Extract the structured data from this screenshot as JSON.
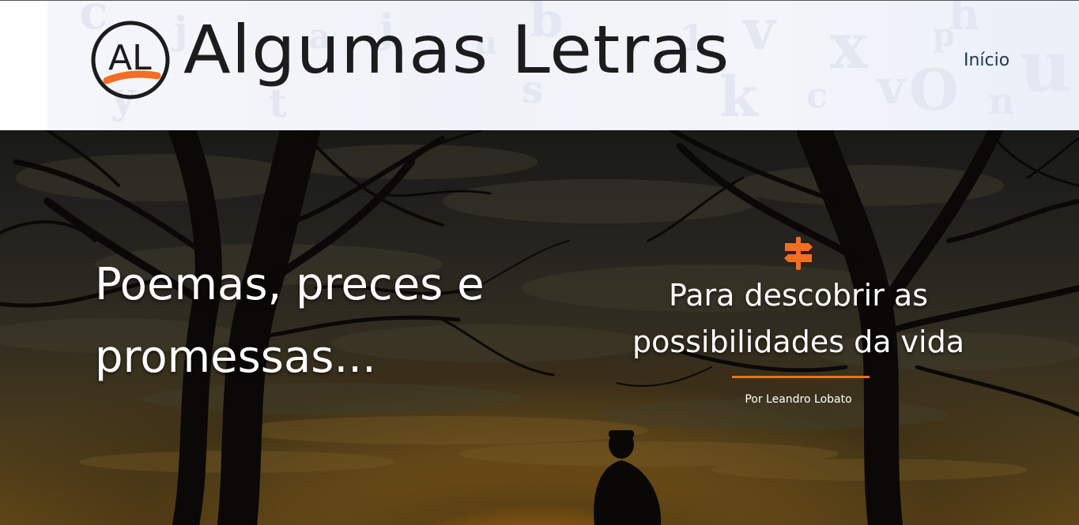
{
  "header": {
    "logo_monogram": "AL",
    "logo_text": "Algumas Letras",
    "nav": [
      {
        "label": "Início"
      }
    ]
  },
  "hero": {
    "title": "Poemas, preces e promessas...",
    "tagline": "Para descobrir as possibilidades da vida",
    "author": "Por Leandro Lobato",
    "icon": "signpost-icon"
  },
  "colors": {
    "accent": "#f26f22",
    "nav_text": "#1f3658",
    "logo_text": "#1c1c1c",
    "hero_text": "#ffffff"
  }
}
